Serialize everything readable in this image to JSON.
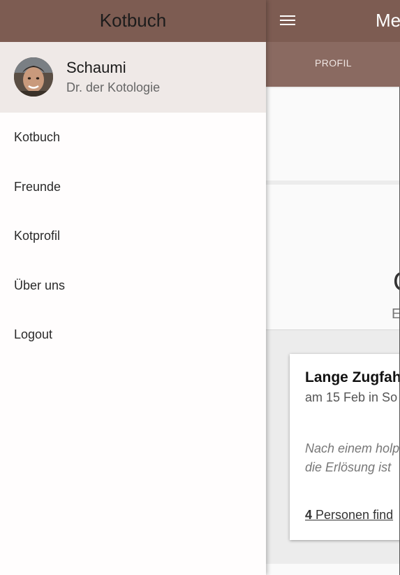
{
  "app": {
    "title": "Me",
    "tabs": [
      {
        "label": "PROFIL"
      }
    ],
    "profile_initial": "C",
    "profile_subtitle": "E",
    "card": {
      "title": "Lange Zugfah",
      "meta": "am 15 Feb in So",
      "text_line1": "Nach einem holp",
      "text_line2": "die Erlösung ist",
      "link_count": "4",
      "link_text": " Personen find"
    }
  },
  "drawer": {
    "title": "Kotbuch",
    "user": {
      "name": "Schaumi",
      "role": "Dr. der Kotologie"
    },
    "items": [
      {
        "label": "Kotbuch"
      },
      {
        "label": "Freunde"
      },
      {
        "label": "Kotprofil"
      },
      {
        "label": "Über uns"
      },
      {
        "label": "Logout"
      }
    ]
  },
  "colors": {
    "brand": "#7d5c52",
    "tab_bar": "#8a6a61",
    "profile_bg": "#efe9e7"
  }
}
